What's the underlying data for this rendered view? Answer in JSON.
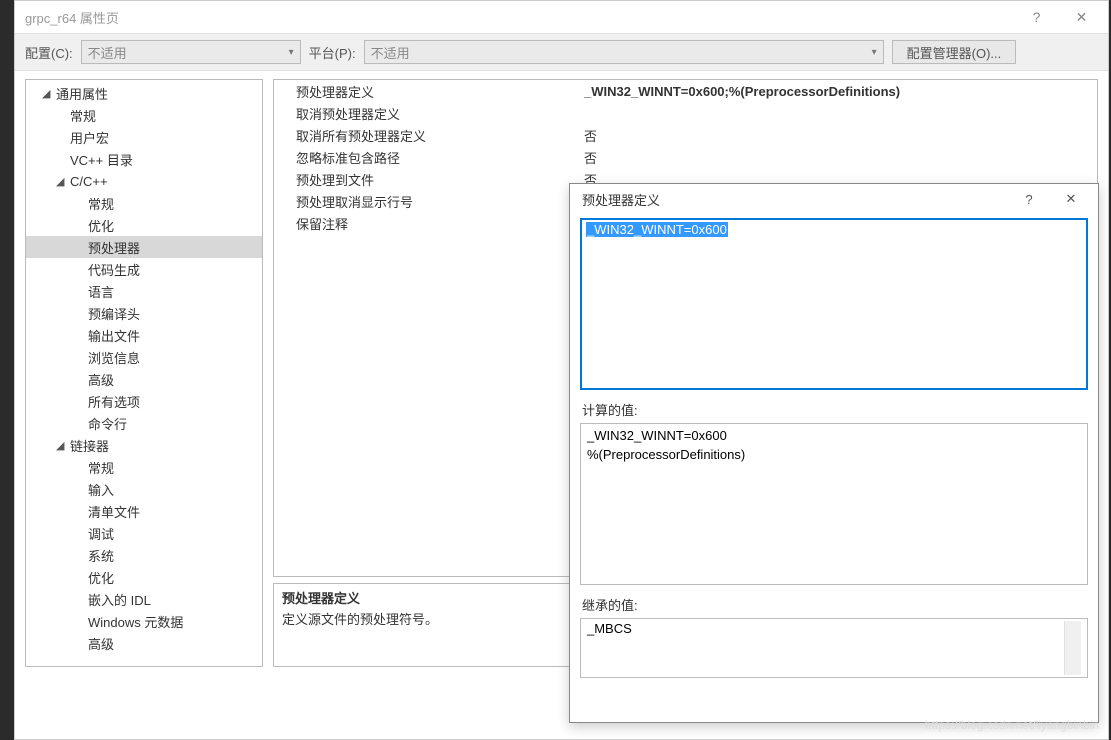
{
  "titlebar": {
    "title": "grpc_r64 属性页"
  },
  "toolbar": {
    "config_label": "配置(C):",
    "config_value": "不适用",
    "platform_label": "平台(P):",
    "platform_value": "不适用",
    "manager_button": "配置管理器(O)..."
  },
  "tree": {
    "common_properties": "通用属性",
    "general": "常规",
    "user_macros": "用户宏",
    "vc_dirs": "VC++ 目录",
    "c_cpp": "C/C++",
    "cpp_general": "常规",
    "optimization": "优化",
    "preprocessor": "预处理器",
    "code_gen": "代码生成",
    "language": "语言",
    "precompiled": "预编译头",
    "output_files": "输出文件",
    "browse_info": "浏览信息",
    "advanced": "高级",
    "all_options": "所有选项",
    "cmdline": "命令行",
    "linker": "链接器",
    "lk_general": "常规",
    "lk_input": "输入",
    "lk_manifest": "清单文件",
    "lk_debug": "调试",
    "lk_system": "系统",
    "lk_opt": "优化",
    "lk_idl": "嵌入的 IDL",
    "lk_winmeta": "Windows 元数据",
    "lk_adv": "高级"
  },
  "grid": {
    "rows": [
      {
        "key": "预处理器定义",
        "val": "_WIN32_WINNT=0x600;%(PreprocessorDefinitions)",
        "bold": true
      },
      {
        "key": "取消预处理器定义",
        "val": ""
      },
      {
        "key": "取消所有预处理器定义",
        "val": "否"
      },
      {
        "key": "忽略标准包含路径",
        "val": "否"
      },
      {
        "key": "预处理到文件",
        "val": "否"
      },
      {
        "key": "预处理取消显示行号",
        "val": ""
      },
      {
        "key": "保留注释",
        "val": ""
      }
    ]
  },
  "description": {
    "title": "预处理器定义",
    "body": "定义源文件的预处理符号。"
  },
  "popup": {
    "title": "预处理器定义",
    "edit_value": "_WIN32_WINNT=0x600",
    "calc_label": "计算的值:",
    "calc_value_1": "_WIN32_WINNT=0x600",
    "calc_value_2": "%(PreprocessorDefinitions)",
    "inherit_label": "继承的值:",
    "inherit_value": "_MBCS"
  },
  "watermark": "https://blog.csdn.net/liyangbinbin"
}
